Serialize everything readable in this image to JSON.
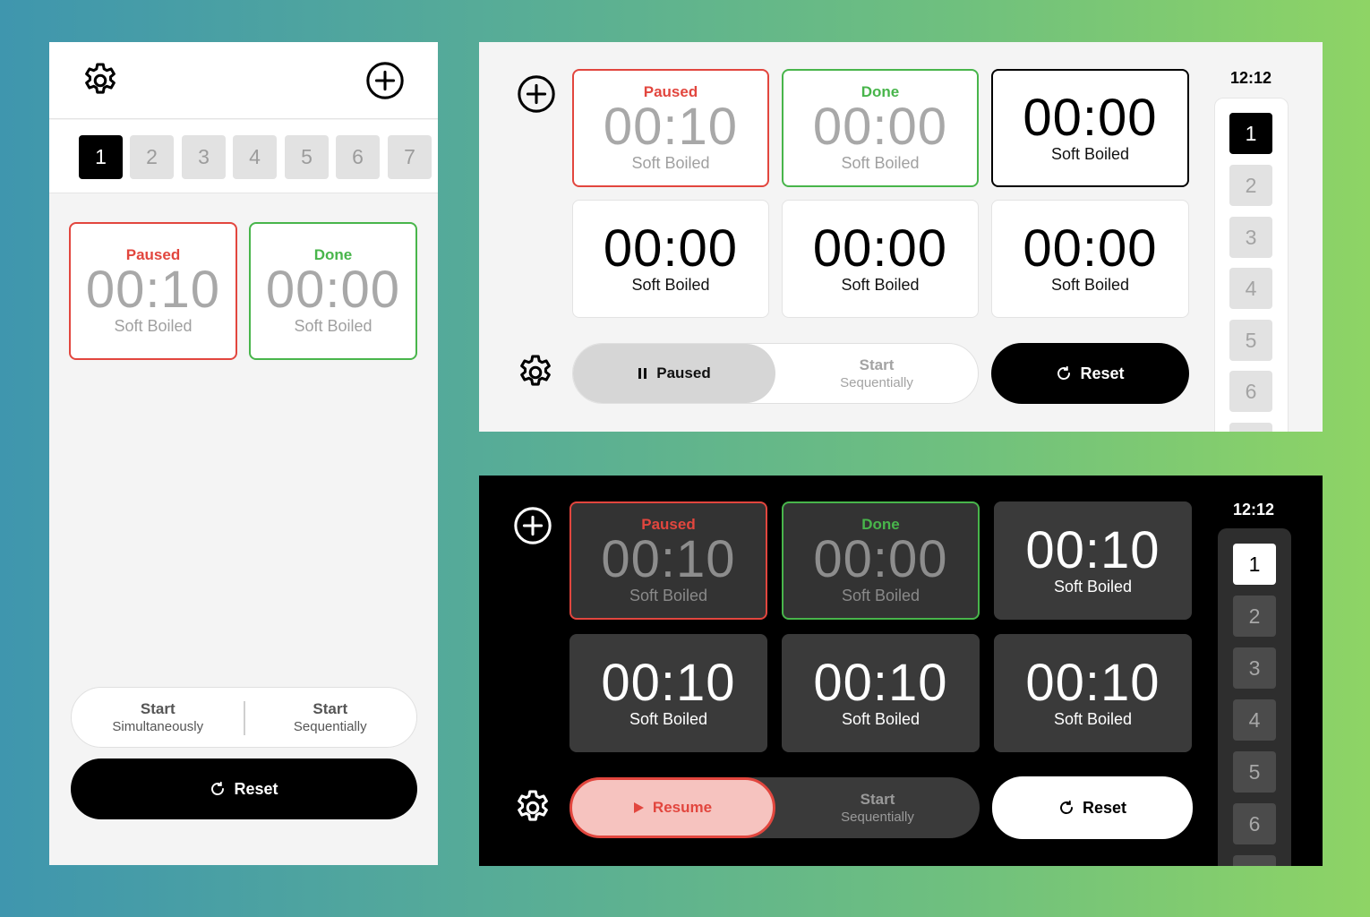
{
  "mobile": {
    "pages": [
      "1",
      "2",
      "3",
      "4",
      "5",
      "6",
      "7"
    ],
    "cards": [
      {
        "status": "Paused",
        "time": "00:10",
        "label": "Soft Boiled"
      },
      {
        "status": "Done",
        "time": "00:00",
        "label": "Soft Boiled"
      }
    ],
    "start_simultaneously": {
      "title": "Start",
      "sub": "Simultaneously"
    },
    "start_sequentially": {
      "title": "Start",
      "sub": "Sequentially"
    },
    "reset_label": "Reset"
  },
  "tablet_light": {
    "clock": "12:12",
    "cards": [
      {
        "status": "Paused",
        "time": "00:10",
        "label": "Soft Boiled"
      },
      {
        "status": "Done",
        "time": "00:00",
        "label": "Soft Boiled"
      },
      {
        "status": "",
        "time": "00:00",
        "label": "Soft Boiled"
      },
      {
        "status": "",
        "time": "00:00",
        "label": "Soft Boiled"
      },
      {
        "status": "",
        "time": "00:00",
        "label": "Soft Boiled"
      },
      {
        "status": "",
        "time": "00:00",
        "label": "Soft Boiled"
      }
    ],
    "paused_label": "Paused",
    "start_sequentially": {
      "title": "Start",
      "sub": "Sequentially"
    },
    "reset_label": "Reset",
    "pages": [
      "1",
      "2",
      "3",
      "4",
      "5",
      "6"
    ]
  },
  "tablet_dark": {
    "clock": "12:12",
    "cards": [
      {
        "status": "Paused",
        "time": "00:10",
        "label": "Soft Boiled"
      },
      {
        "status": "Done",
        "time": "00:00",
        "label": "Soft Boiled"
      },
      {
        "status": "",
        "time": "00:10",
        "label": "Soft Boiled"
      },
      {
        "status": "",
        "time": "00:10",
        "label": "Soft Boiled"
      },
      {
        "status": "",
        "time": "00:10",
        "label": "Soft Boiled"
      },
      {
        "status": "",
        "time": "00:10",
        "label": "Soft Boiled"
      }
    ],
    "resume_label": "Resume",
    "start_sequentially": {
      "title": "Start",
      "sub": "Sequentially"
    },
    "reset_label": "Reset",
    "pages": [
      "1",
      "2",
      "3",
      "4",
      "5",
      "6"
    ]
  },
  "icons": {
    "settings": "gear-icon",
    "add": "plus-circle-icon",
    "reset": "refresh-icon",
    "pause": "pause-icon",
    "play": "play-icon"
  },
  "colors": {
    "paused": "#e2463e",
    "done": "#48b54b",
    "resume_fill": "#f6c3bf"
  }
}
